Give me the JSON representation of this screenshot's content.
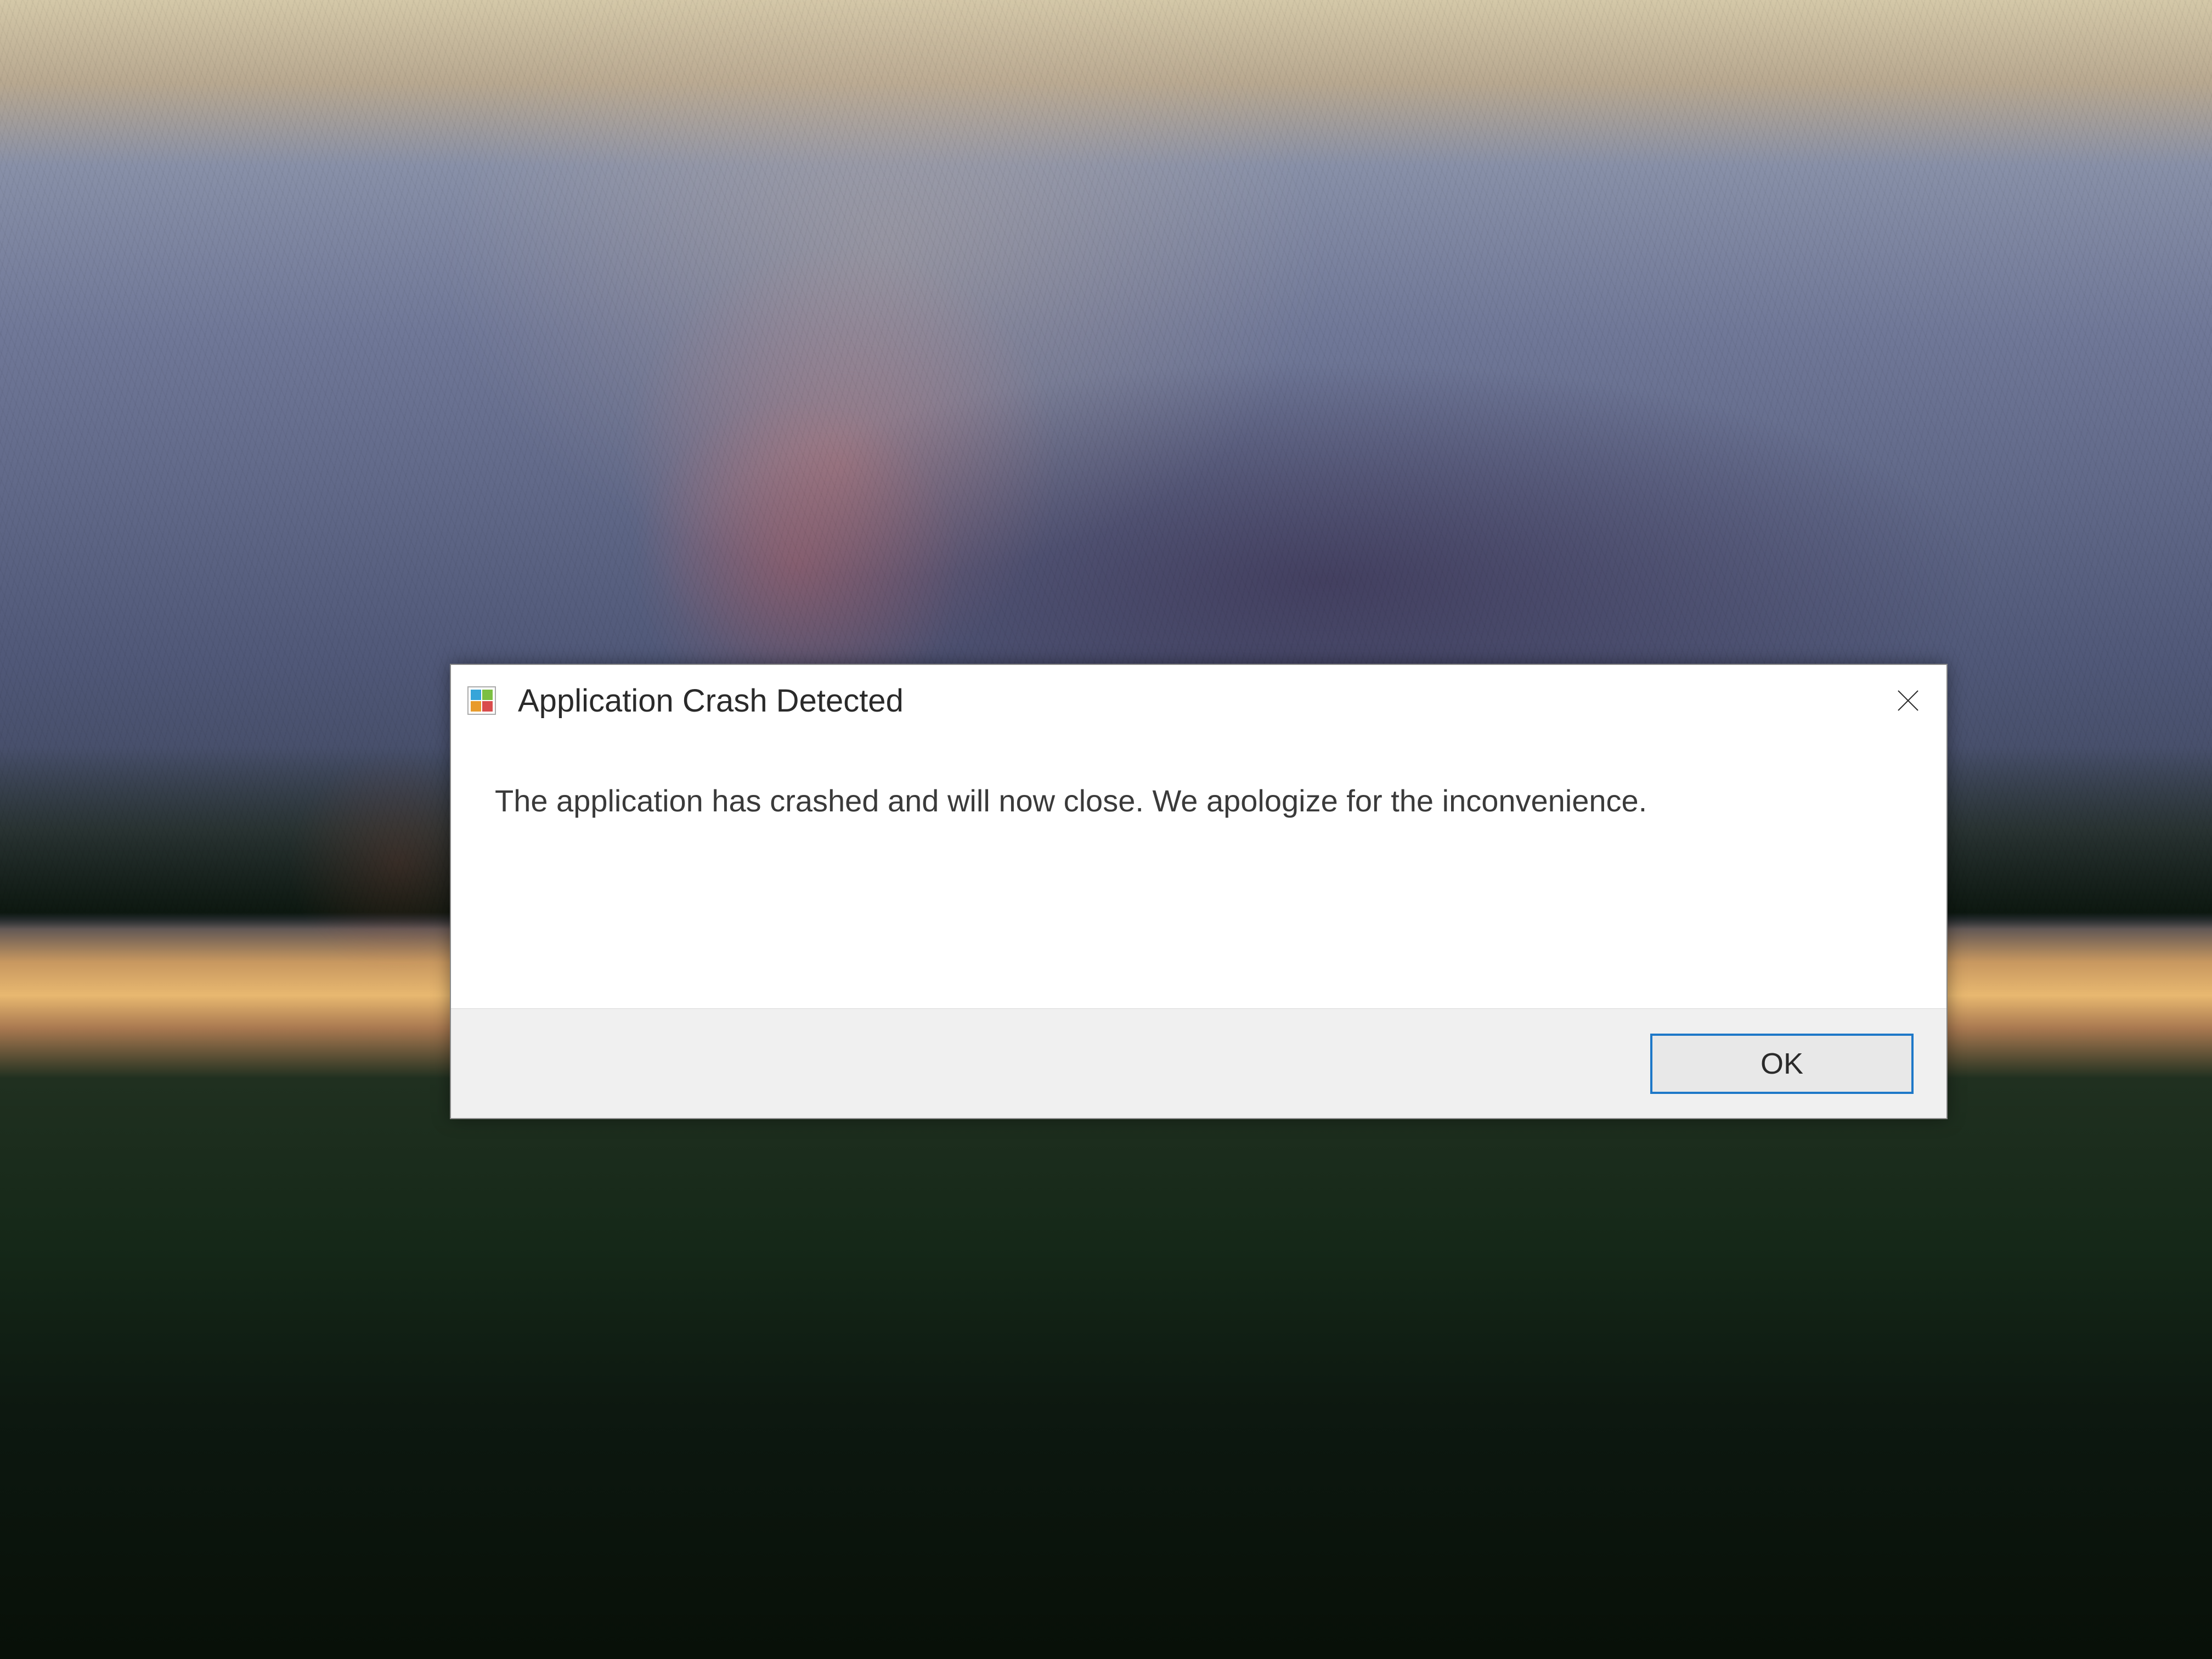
{
  "dialog": {
    "title": "Application Crash Detected",
    "body_text": "The application has crashed and will now close. We apologize for the inconvenience.",
    "ok_label": "OK"
  }
}
